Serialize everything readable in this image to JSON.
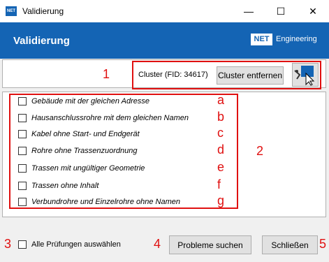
{
  "window": {
    "title": "Validierung",
    "icon_text": "NET",
    "minimize": "—",
    "maximize": "☐",
    "close": "✕"
  },
  "header": {
    "title": "Validierung",
    "logo_badge": "NET",
    "logo_text": "Engineering"
  },
  "toolbar": {
    "cluster_label": "Cluster (FID: 34617)",
    "remove_cluster_label": "Cluster entfernen",
    "annotation_number": "1"
  },
  "checks": {
    "annotation_number": "2",
    "items": [
      {
        "label": "Gebäude mit der gleichen Adresse",
        "letter": "a",
        "checked": false
      },
      {
        "label": "Hausanschlussrohre mit dem gleichen Namen",
        "letter": "b",
        "checked": false
      },
      {
        "label": "Kabel ohne Start- und Endgerät",
        "letter": "c",
        "checked": false
      },
      {
        "label": "Rohre ohne Trassenzuordnung",
        "letter": "d",
        "checked": false
      },
      {
        "label": "Trassen mit ungültiger Geometrie",
        "letter": "e",
        "checked": false
      },
      {
        "label": "Trassen ohne Inhalt",
        "letter": "f",
        "checked": false
      },
      {
        "label": "Verbundrohre und Einzelrohre ohne Namen",
        "letter": "g",
        "checked": false
      }
    ]
  },
  "footer": {
    "select_all_label": "Alle Prüfungen auswählen",
    "select_all_number": "3",
    "search_button": "Probleme suchen",
    "search_number": "4",
    "close_button": "Schließen",
    "close_number": "5"
  },
  "colors": {
    "brand": "#1464b4",
    "annotation": "#e01010"
  }
}
